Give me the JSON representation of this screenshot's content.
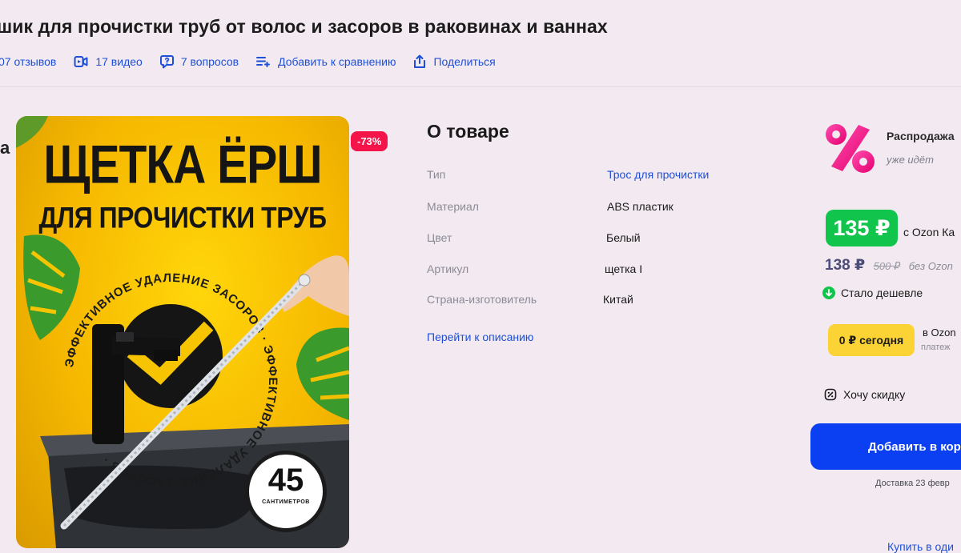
{
  "product": {
    "title": "шик для прочистки труб от волос и засоров в раковинах и ваннах",
    "reviews": "07 отзывов",
    "videos": "17 видео",
    "questions": "7 вопросов",
    "compare": "Добавить к сравнению",
    "share": "Поделиться"
  },
  "image": {
    "discount_badge": "-73%",
    "headline": "ЩЕТКА ЁРШ",
    "subheadline": "ДЛЯ ПРОЧИСТКИ ТРУБ",
    "ring_text": "ЭФФЕКТИВНОЕ УДАЛЕНИЕ ЗАСОРОВ · ЭФФЕКТИВНОЕ УДАЛЕНИЕ ЗАСОРОВ ·",
    "length_value": "45",
    "length_unit": "САНТИМЕТРОВ",
    "edge_glyph": "a"
  },
  "about": {
    "title": "О товаре",
    "specs": [
      {
        "key": "Тип",
        "value": "Трос для прочистки",
        "is_link": true
      },
      {
        "key": "Материал",
        "value": "ABS пластик",
        "is_link": false
      },
      {
        "key": "Цвет",
        "value": "Белый",
        "is_link": false
      },
      {
        "key": "Артикул",
        "value": "щетка I",
        "is_link": false
      },
      {
        "key": "Страна-изготовитель",
        "value": "Китай",
        "is_link": false
      }
    ],
    "go_to_description": "Перейти к описанию"
  },
  "pricing": {
    "sale_title": "Распродажа",
    "sale_subtitle": "уже идёт",
    "card_price": "135 ₽",
    "card_price_caption": "с Ozon Ка",
    "regular_price": "138 ₽",
    "old_price": "500 ₽",
    "regular_caption": "без Ozon",
    "cheaper_label": "Стало дешевле",
    "pay_today": "0 ₽ сегодня",
    "pay_caption_1": "в Ozon",
    "pay_caption_2": "платеж",
    "want_discount": "Хочу скидку",
    "add_to_cart": "Добавить в кор",
    "delivery": "Доставка 23 февр",
    "buy_link": "Купить в оди"
  },
  "colors": {
    "link_blue": "#1e4fd8",
    "discount_red": "#f5144a",
    "card_price_green": "#10c44c",
    "installment_yellow": "#fbd335",
    "cart_blue": "#0b3ff2",
    "page_background": "#f3eaf1"
  },
  "icons": {
    "reviews": "star-icon",
    "videos": "video-icon",
    "questions": "question-bubble-icon",
    "compare": "compare-list-icon",
    "share": "share-icon",
    "sale": "percent-icon",
    "cheaper": "down-arrow-icon",
    "want_discount": "discount-chat-icon"
  }
}
